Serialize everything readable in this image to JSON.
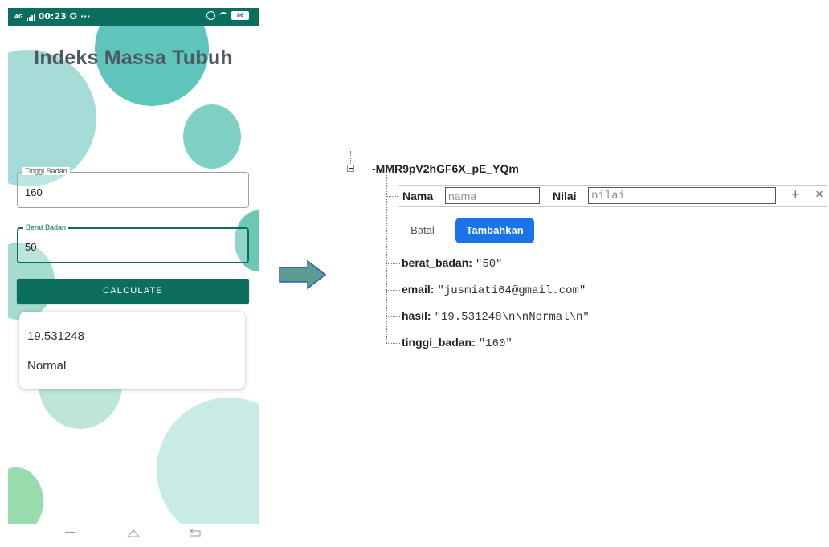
{
  "phone": {
    "status_bar": {
      "network": "4G",
      "time": "00:23",
      "more": "···",
      "battery": "86"
    },
    "app_title": "Indeks Massa Tubuh",
    "tinggi": {
      "label": "Tinggi Badan",
      "value": "160"
    },
    "berat": {
      "label": "Berat Badan",
      "value": "50"
    },
    "calculate_label": "CALCULATE",
    "result": {
      "value": "19.531248",
      "status": "Normal"
    }
  },
  "tree": {
    "node_key": "-MMR9pV2hGF6X_pE_YQm",
    "add_form": {
      "nama_label": "Nama",
      "nama_placeholder": "nama",
      "nilai_label": "Nilai",
      "nilai_placeholder": "nilai",
      "add_icon": "+",
      "close_icon": "×"
    },
    "batal_label": "Batal",
    "tambahkan_label": "Tambahkan",
    "fields": [
      {
        "key": "berat_badan:",
        "value": "\"50\""
      },
      {
        "key": "email:",
        "value": "\"jusmiati64@gmail.com\""
      },
      {
        "key": "hasil:",
        "value": "\"19.531248\\n\\nNormal\\n\""
      },
      {
        "key": "tinggi_badan:",
        "value": "\"160\""
      }
    ]
  },
  "colors": {
    "primary": "#0b6e5e",
    "accent_button": "#1a73e8",
    "arrow": "#5d9c93"
  }
}
